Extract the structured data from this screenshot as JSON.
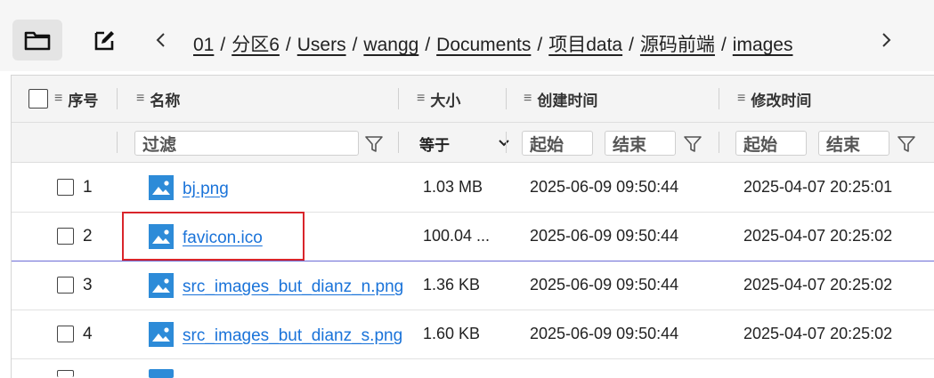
{
  "toolbar": {
    "folder_icon": "folder-icon",
    "edit_icon": "edit-icon",
    "back_icon": "chevron-left-icon",
    "forward_icon": "chevron-right-icon"
  },
  "breadcrumb": [
    "01",
    "分区6",
    "Users",
    "wangg",
    "Documents",
    "项目data",
    "源码前端",
    "images"
  ],
  "breadcrumb_separator": "/",
  "table": {
    "headers": {
      "index": "序号",
      "name": "名称",
      "size": "大小",
      "created": "创建时间",
      "modified": "修改时间"
    },
    "menu_glyph": "≡",
    "filters": {
      "name_placeholder": "过滤",
      "size_op": "等于",
      "created_start": "起始",
      "created_end": "结束",
      "modified_start": "起始",
      "modified_end": "结束"
    },
    "rows": [
      {
        "index": "1",
        "name": "bj.png",
        "size": "1.03 MB",
        "created": "2025-06-09 09:50:44",
        "modified": "2025-04-07 20:25:01"
      },
      {
        "index": "2",
        "name": "favicon.ico",
        "size": "100.04 ...",
        "created": "2025-06-09 09:50:44",
        "modified": "2025-04-07 20:25:02"
      },
      {
        "index": "3",
        "name": "src_images_but_dianz_n.png",
        "size": "1.36 KB",
        "created": "2025-06-09 09:50:44",
        "modified": "2025-04-07 20:25:02"
      },
      {
        "index": "4",
        "name": "src_images_but_dianz_s.png",
        "size": "1.60 KB",
        "created": "2025-06-09 09:50:44",
        "modified": "2025-04-07 20:25:02"
      }
    ]
  },
  "colors": {
    "link": "#1a73d9",
    "file_icon": "#2d8bd8",
    "highlight": "#d9252b",
    "selected_border": "#6b6bd6"
  }
}
